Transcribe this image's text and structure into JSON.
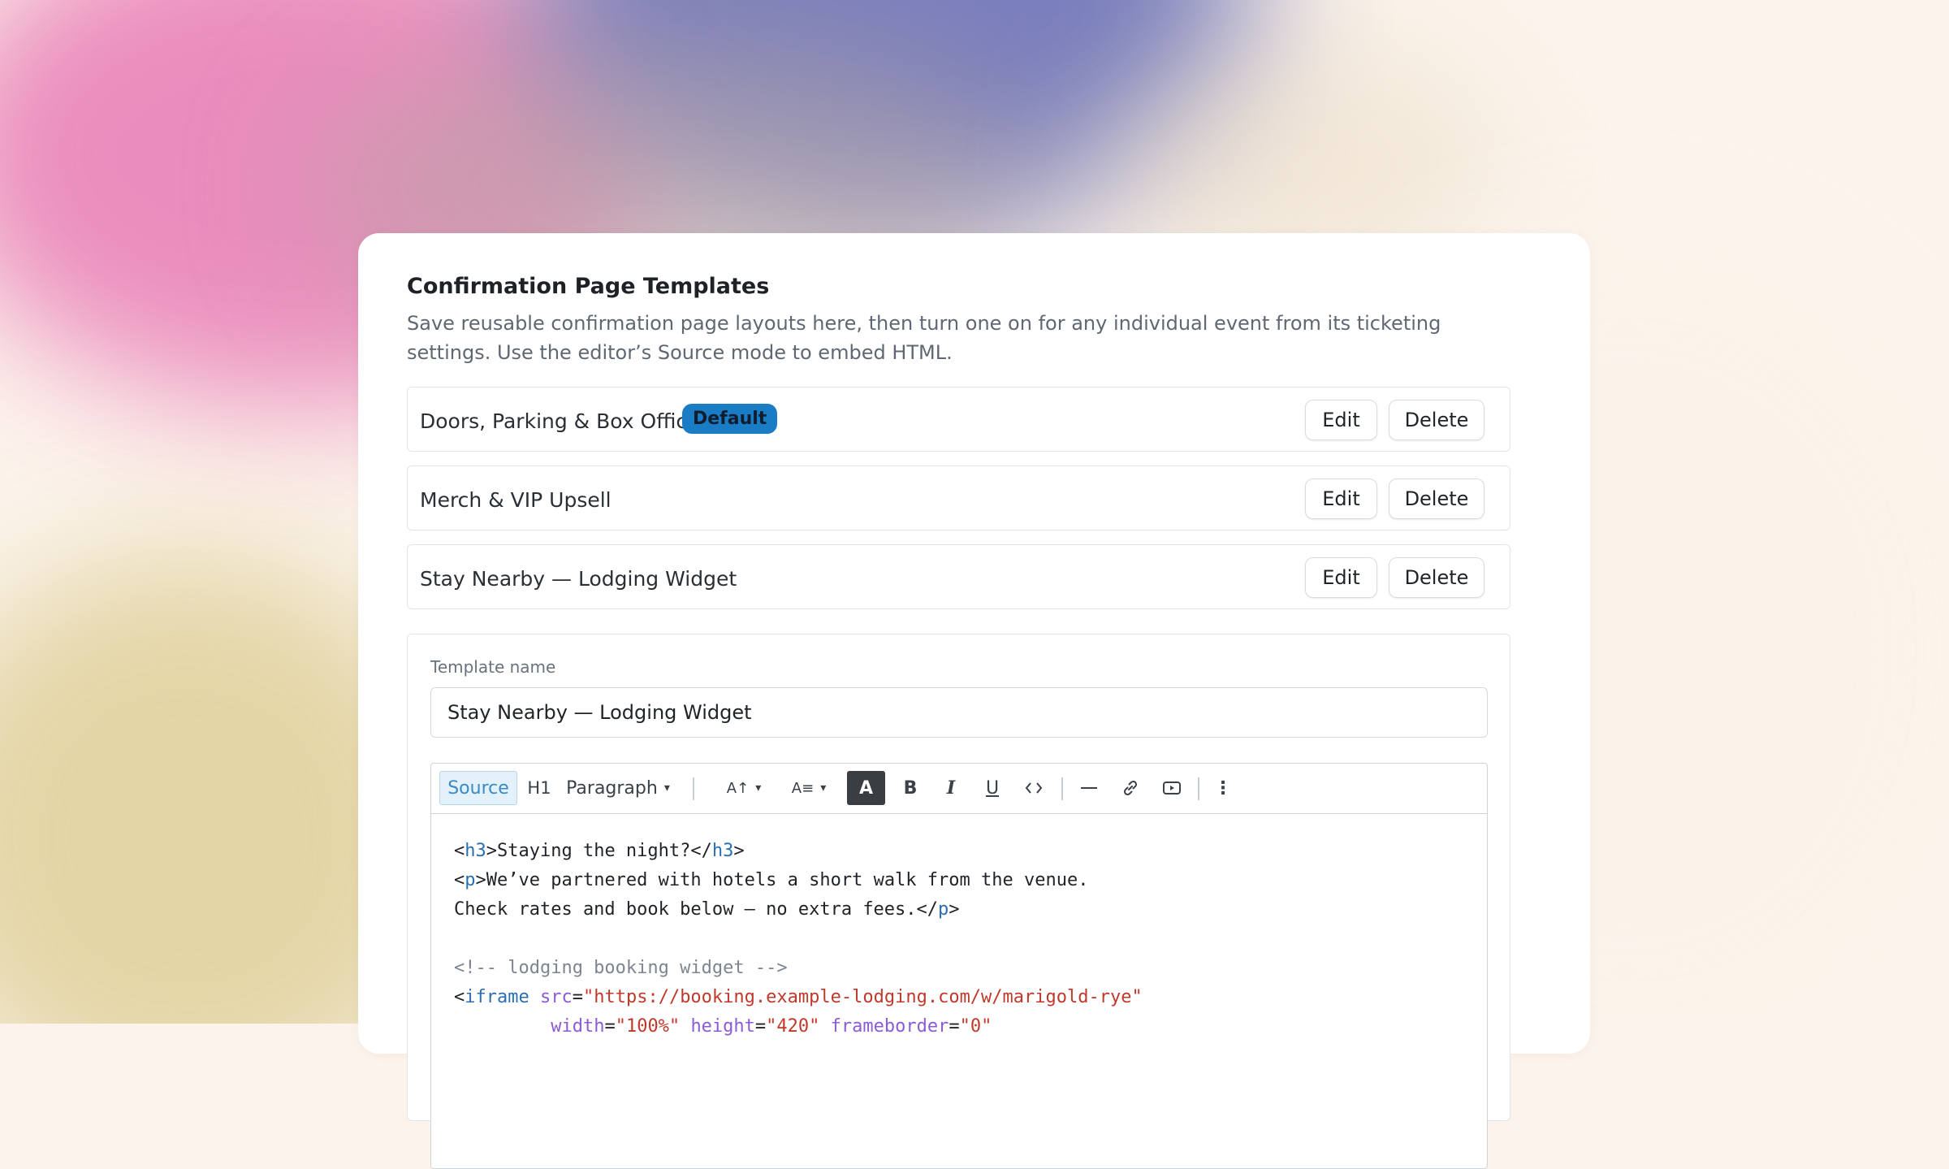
{
  "page": {
    "title": "Confirmation Page Templates",
    "description": "Save reusable confirmation page layouts here, then turn one on for any individual event from its ticketing settings. Use the editor’s Source mode to embed HTML."
  },
  "templates": [
    {
      "name": "Doors, Parking & Box Office",
      "badge": "Default",
      "edit": "Edit",
      "delete": "Delete"
    },
    {
      "name": "Merch & VIP Upsell",
      "edit": "Edit",
      "delete": "Delete"
    },
    {
      "name": "Stay Nearby — Lodging Widget",
      "edit": "Edit",
      "delete": "Delete"
    }
  ],
  "editor": {
    "name_label": "Template name",
    "name_value": "Stay Nearby — Lodging Widget",
    "toolbar": {
      "source": "Source",
      "heading": "H1",
      "paragraph": "Paragraph",
      "font_size": "A↑",
      "font_family": "A≡",
      "font_color": "A",
      "bold": "B",
      "italic": "I",
      "underline": "U",
      "code": "‹›",
      "hr": "—",
      "link": "🔗",
      "media": "▶",
      "more": "⋮"
    },
    "code": {
      "l1_open": "<",
      "l1_tag": "h3",
      "l1_mid": ">Staying the night?</",
      "l1_tag2": "h3",
      "l1_end": ">",
      "l2_open": "<",
      "l2_tag": "p",
      "l2_text": ">We’ve partnered with hotels a short walk from the venue.",
      "l3_text": "Check rates and book below — no extra fees.</",
      "l3_tag": "p",
      "l3_end": ">",
      "l4_comment": "<!-- lodging booking widget -->",
      "l5_open": "<",
      "l5_tag": "iframe",
      "l5_attr": "src",
      "l5_eq": "=",
      "l5_val": "\"https://booking.example-lodging.com/w/marigold-rye\"",
      "l6_indent": "         ",
      "l6_attr1": "width",
      "l6_val1": "\"100%\"",
      "l6_attr2": "height",
      "l6_val2": "\"420\"",
      "l6_attr3": "frameborder",
      "l6_val3": "\"0\""
    }
  }
}
